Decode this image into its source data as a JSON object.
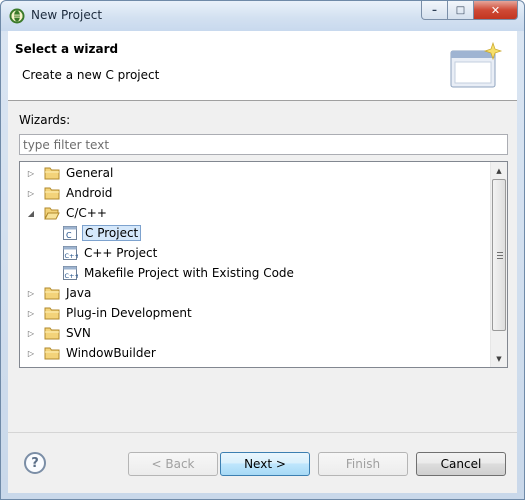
{
  "window": {
    "title": "New Project",
    "caption_buttons": {
      "minimize": "–",
      "maximize": "□",
      "close": "✕"
    }
  },
  "banner": {
    "title": "Select a wizard",
    "description": "Create a new C project"
  },
  "wizards_label": "Wizards:",
  "filter": {
    "value": "",
    "placeholder": "type filter text"
  },
  "tree": {
    "items": [
      {
        "label": "General",
        "expanded": false,
        "type": "folder"
      },
      {
        "label": "Android",
        "expanded": false,
        "type": "folder"
      },
      {
        "label": "C/C++",
        "expanded": true,
        "type": "folder"
      },
      {
        "label": "C Project",
        "type": "c-project",
        "selected": true
      },
      {
        "label": "C++ Project",
        "type": "cpp-project"
      },
      {
        "label": "Makefile Project with Existing Code",
        "type": "makefile-project"
      },
      {
        "label": "Java",
        "expanded": false,
        "type": "folder"
      },
      {
        "label": "Plug-in Development",
        "expanded": false,
        "type": "folder"
      },
      {
        "label": "SVN",
        "expanded": false,
        "type": "folder"
      },
      {
        "label": "WindowBuilder",
        "expanded": false,
        "type": "folder"
      }
    ]
  },
  "buttons": {
    "help": "?",
    "back": "< Back",
    "next": "Next >",
    "finish": "Finish",
    "cancel": "Cancel"
  },
  "colors": {
    "selection_bg": "#d5e8fb",
    "selection_border": "#7da2ce",
    "folder_yellow": "#f3d37a",
    "default_button": "#a7d9f5"
  }
}
